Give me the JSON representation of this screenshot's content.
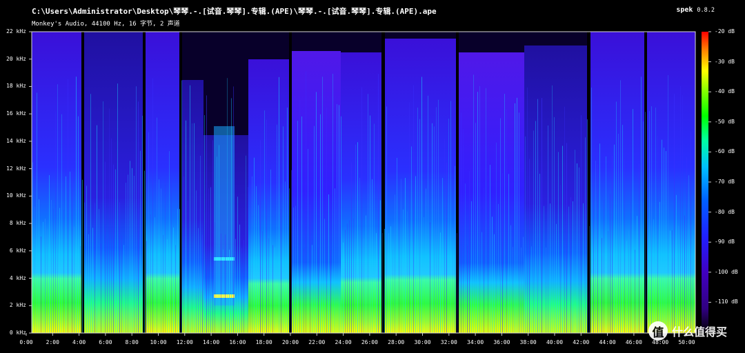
{
  "window": {
    "title": "C:\\Users\\Administrator\\Desktop\\琴琴.-.[试音.琴琴].专辑.(APE)\\琴琴.-.[试音.琴琴].专辑.(APE).ape",
    "subtitle": "Monkey's Audio, 44100 Hz, 16 字节, 2 声道",
    "app_name": "spek",
    "app_version": "0.8.2"
  },
  "spectrogram": {
    "freq_labels": [
      "22 kHz",
      "20 kHz",
      "18 kHz",
      "16 kHz",
      "14 kHz",
      "12 kHz",
      "10 kHz",
      "8 kHz",
      "6 kHz",
      "4 kHz",
      "2 kHz",
      "0 kHz"
    ],
    "time_labels": [
      "0:00",
      "2:00",
      "4:00",
      "6:00",
      "8:00",
      "10:00",
      "12:00",
      "14:00",
      "16:00",
      "18:00",
      "20:00",
      "22:00",
      "24:00",
      "26:00",
      "28:00",
      "30:00",
      "32:00",
      "34:00",
      "36:00",
      "38:00",
      "40:00",
      "42:00",
      "44:00",
      "46:00",
      "48:00",
      "50:00"
    ],
    "db_labels": [
      "-20 dB",
      "-30 dB",
      "-40 dB",
      "-50 dB",
      "-60 dB",
      "-70 dB",
      "-80 dB",
      "-90 dB",
      "-100 dB",
      "-110 dB"
    ],
    "colormap": [
      "#ff0000",
      "#ff8000",
      "#ffff00",
      "#80ff00",
      "#00ff00",
      "#00ffa0",
      "#00c0ff",
      "#0060ff",
      "#2020ff",
      "#4000c0",
      "#300080",
      "#000000"
    ]
  },
  "watermark": {
    "logo_char": "值",
    "text": "什么值得买"
  }
}
